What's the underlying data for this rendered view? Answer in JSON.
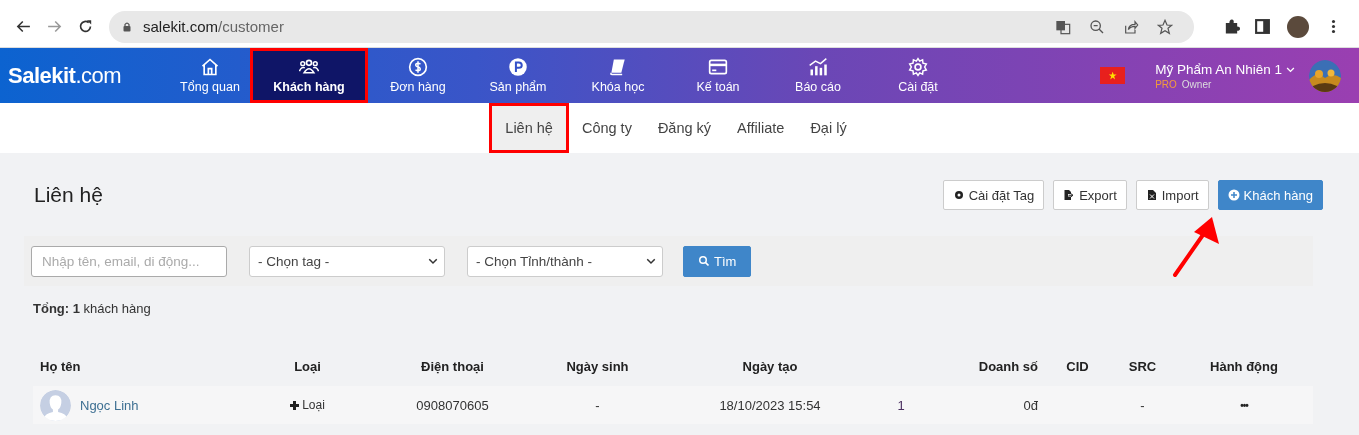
{
  "browser": {
    "url_host": "salekit.com",
    "url_path": "/customer"
  },
  "app": {
    "logo": "Salekit",
    "logo_suffix": ".com",
    "nav": [
      {
        "label": "Tổng quan",
        "kind": "home",
        "selected": false,
        "highlighted": false
      },
      {
        "label": "Khách hàng",
        "kind": "users",
        "selected": true,
        "highlighted": true
      },
      {
        "label": "Đơn hàng",
        "kind": "dollar",
        "selected": false,
        "highlighted": false
      },
      {
        "label": "Sản phẩm",
        "kind": "p",
        "selected": false,
        "highlighted": false
      },
      {
        "label": "Khóa học",
        "kind": "book",
        "selected": false,
        "highlighted": false
      },
      {
        "label": "Kế toán",
        "kind": "card",
        "selected": false,
        "highlighted": false
      },
      {
        "label": "Báo cáo",
        "kind": "chart",
        "selected": false,
        "highlighted": false
      },
      {
        "label": "Cài đặt",
        "kind": "gear",
        "selected": false,
        "highlighted": false
      }
    ],
    "account": {
      "name": "Mỹ Phẩm An Nhiên 1",
      "plan": "PRO",
      "role": "Owner"
    }
  },
  "subtabs": [
    {
      "label": "Liên hệ",
      "selected": true,
      "highlighted": true
    },
    {
      "label": "Công ty",
      "selected": false,
      "highlighted": false
    },
    {
      "label": "Đăng ký",
      "selected": false,
      "highlighted": false
    },
    {
      "label": "Affiliate",
      "selected": false,
      "highlighted": false
    },
    {
      "label": "Đại lý",
      "selected": false,
      "highlighted": false
    }
  ],
  "page": {
    "title": "Liên hệ",
    "actions": [
      {
        "label": "Cài đặt Tag",
        "kind": "settings"
      },
      {
        "label": "Export",
        "kind": "export"
      },
      {
        "label": "Import",
        "kind": "import"
      },
      {
        "label": "Khách hàng",
        "kind": "add"
      }
    ],
    "annotation_arrow": true,
    "filters": {
      "search": {
        "placeholder": "Nhập tên, email, di động..."
      },
      "tag": {
        "value": "- Chọn tag -"
      },
      "province": {
        "value": "- Chọn Tỉnh/thành -"
      },
      "button": "Tìm"
    },
    "total": {
      "label": "Tổng:",
      "count": "1",
      "unit": "khách hàng"
    }
  },
  "table": {
    "columns": [
      {
        "label": "Họ tên"
      },
      {
        "label": "Loại"
      },
      {
        "label": "Điện thoại"
      },
      {
        "label": "Ngày sinh"
      },
      {
        "label": "Ngày tạo"
      },
      {},
      {
        "label": "Doanh số"
      },
      {
        "label": "CID"
      },
      {
        "label": "SRC"
      },
      {
        "label": "Hành động"
      }
    ],
    "rows": [
      {
        "name": "Ngọc Linh",
        "type": "Loại",
        "phone": "0908070605",
        "birthday": "-",
        "created": "18/10/2023 15:54",
        "column_6": "1",
        "revenue": "0đ",
        "src": "-",
        "actions": "•••"
      }
    ]
  }
}
